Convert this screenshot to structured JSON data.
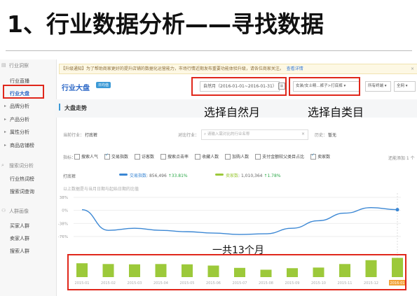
{
  "slide": {
    "title": "1、行业数据分析——寻找数据"
  },
  "sidebar": {
    "sections": [
      {
        "header": "行业洞察",
        "items": [
          "行业直播",
          "行业大盘"
        ],
        "subitems": [
          "品牌分析",
          "产品分析",
          "属性分析",
          "商品店铺榜"
        ]
      },
      {
        "header": "搜索词分析",
        "items": [
          "行业热词榜",
          "搜索词查询"
        ]
      },
      {
        "header": "人群画像",
        "items": [
          "买家人群",
          "卖家人群",
          "搜索人群"
        ]
      }
    ]
  },
  "notice": {
    "text": "【升级通知】为了帮助商家更好的提升店铺的数据化运营能力，市场行情近期发布重要功能体验升级，请各位商家关注。",
    "link": "查看详情",
    "close": "×"
  },
  "module": {
    "title": "行业大盘",
    "badge": "日均值"
  },
  "filters": {
    "date": "自然月（2016-01-01~2016-01-31）",
    "category": "女装/女士精...裤子>打底裤",
    "terminal": "所有终端",
    "scope": "全网"
  },
  "trend": {
    "title": "大盘走势"
  },
  "callouts": {
    "date": "选择自然月",
    "category": "选择自类目",
    "months": "一共13个月"
  },
  "fields": {
    "current_label": "当前行业：",
    "current_value": "打底裤",
    "compare_label": "对比行业：",
    "compare_placeholder": "请输入需对比的行业名称",
    "history_label": "历史：",
    "history_value": "暂无",
    "add_note": "还能添加 1 个"
  },
  "metrics": {
    "label": "指标：",
    "items": [
      {
        "label": "搜索人气",
        "checked": false
      },
      {
        "label": "交易指数",
        "checked": true
      },
      {
        "label": "访客数",
        "checked": false
      },
      {
        "label": "搜索点击率",
        "checked": false
      },
      {
        "label": "收藏人数",
        "checked": false
      },
      {
        "label": "加购人数",
        "checked": false
      },
      {
        "label": "支付金额较父类目占比",
        "checked": false
      },
      {
        "label": "卖家数",
        "checked": true
      }
    ]
  },
  "chart_legend": {
    "industry": "打底裤",
    "series1": {
      "name": "交易指数",
      "value": "856,496",
      "change": "33.81%",
      "color": "#3b87d4"
    },
    "series2": {
      "name": "卖家数",
      "value": "1,010,364",
      "change": "1.78%",
      "color": "#9cc93a"
    },
    "note": "以上数据是与当月日期与起始日期的比值"
  },
  "chart_data": {
    "type": "line+bar",
    "categories": [
      "2015-01",
      "2015-02",
      "2015-03",
      "2015-04",
      "2015-05",
      "2015-06",
      "2015-07",
      "2015-08",
      "2015-09",
      "2015-10",
      "2015-11",
      "2015-12",
      "2016-01"
    ],
    "y_ticks": [
      "38%",
      "0%",
      "-38%",
      "-76%"
    ],
    "ylim": [
      -90,
      40
    ],
    "series": [
      {
        "name": "交易指数",
        "values": [
          2,
          -58,
          -52,
          -58,
          -62,
          -66,
          -70,
          -68,
          -52,
          -30,
          -8,
          8,
          2
        ]
      },
      {
        "name": "卖家数",
        "values": [
          9,
          8.5,
          8.3,
          8.5,
          8.3,
          7.5,
          6,
          4.8,
          5.8,
          6.2,
          8.5,
          11,
          12.5
        ]
      }
    ],
    "highlight_category": "2016-01"
  }
}
